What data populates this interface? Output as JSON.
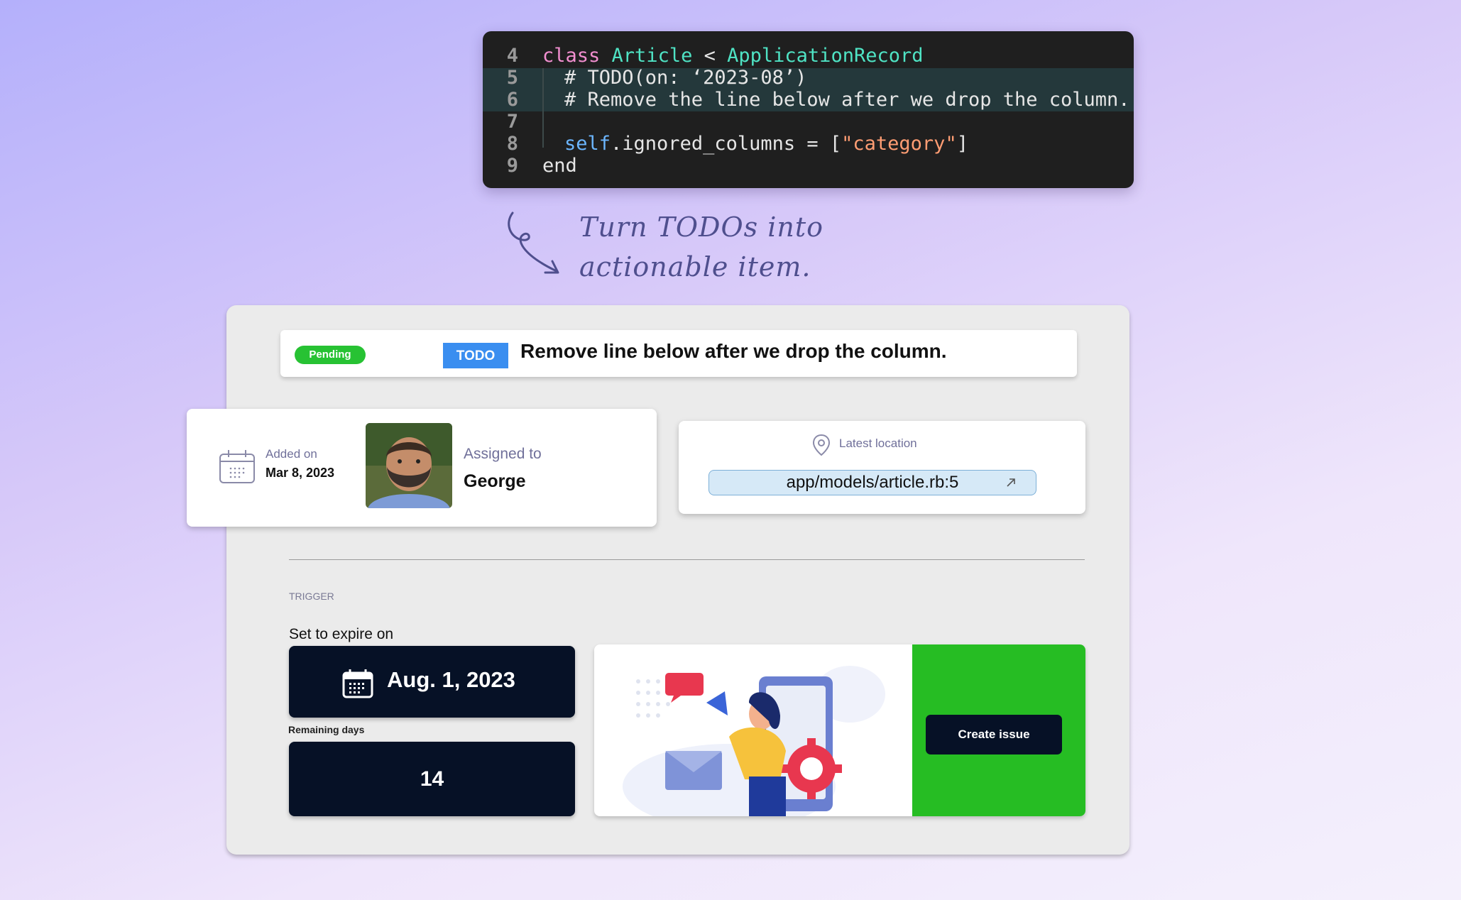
{
  "code": {
    "line_numbers": [
      "4",
      "5",
      "6",
      "7",
      "8",
      "9"
    ],
    "line1": {
      "kw": "class",
      "cls": "Article",
      "op": "<",
      "parent": "ApplicationRecord"
    },
    "line2": "# TODO(on: ‘2023-08’)",
    "line3": "# Remove the line below after we drop the column.",
    "line5": {
      "self": "self",
      "rest": ".ignored_columns = [",
      "str": "\"category\"",
      "close": "]"
    },
    "line6": "end"
  },
  "annotation": {
    "line1": "Turn TODOs into",
    "line2": "actionable item."
  },
  "todo": {
    "status": "Pending",
    "tag": "TODO",
    "text": "Remove line below after we drop the column."
  },
  "added": {
    "label": "Added on",
    "date": "Mar 8, 2023"
  },
  "assigned": {
    "label": "Assigned to",
    "name": "George"
  },
  "location": {
    "label": "Latest location",
    "path": "app/models/article.rb:5"
  },
  "trigger": {
    "heading": "TRIGGER",
    "expire_label": "Set to expire on",
    "expire_date": "Aug. 1, 2023",
    "remaining_label": "Remaining days",
    "remaining_days": "14"
  },
  "actions": {
    "create_issue": "Create issue"
  },
  "colors": {
    "pending": "#27c233",
    "todo_tag": "#3a8ef0",
    "dark": "#061126",
    "green_panel": "#26bd23"
  }
}
